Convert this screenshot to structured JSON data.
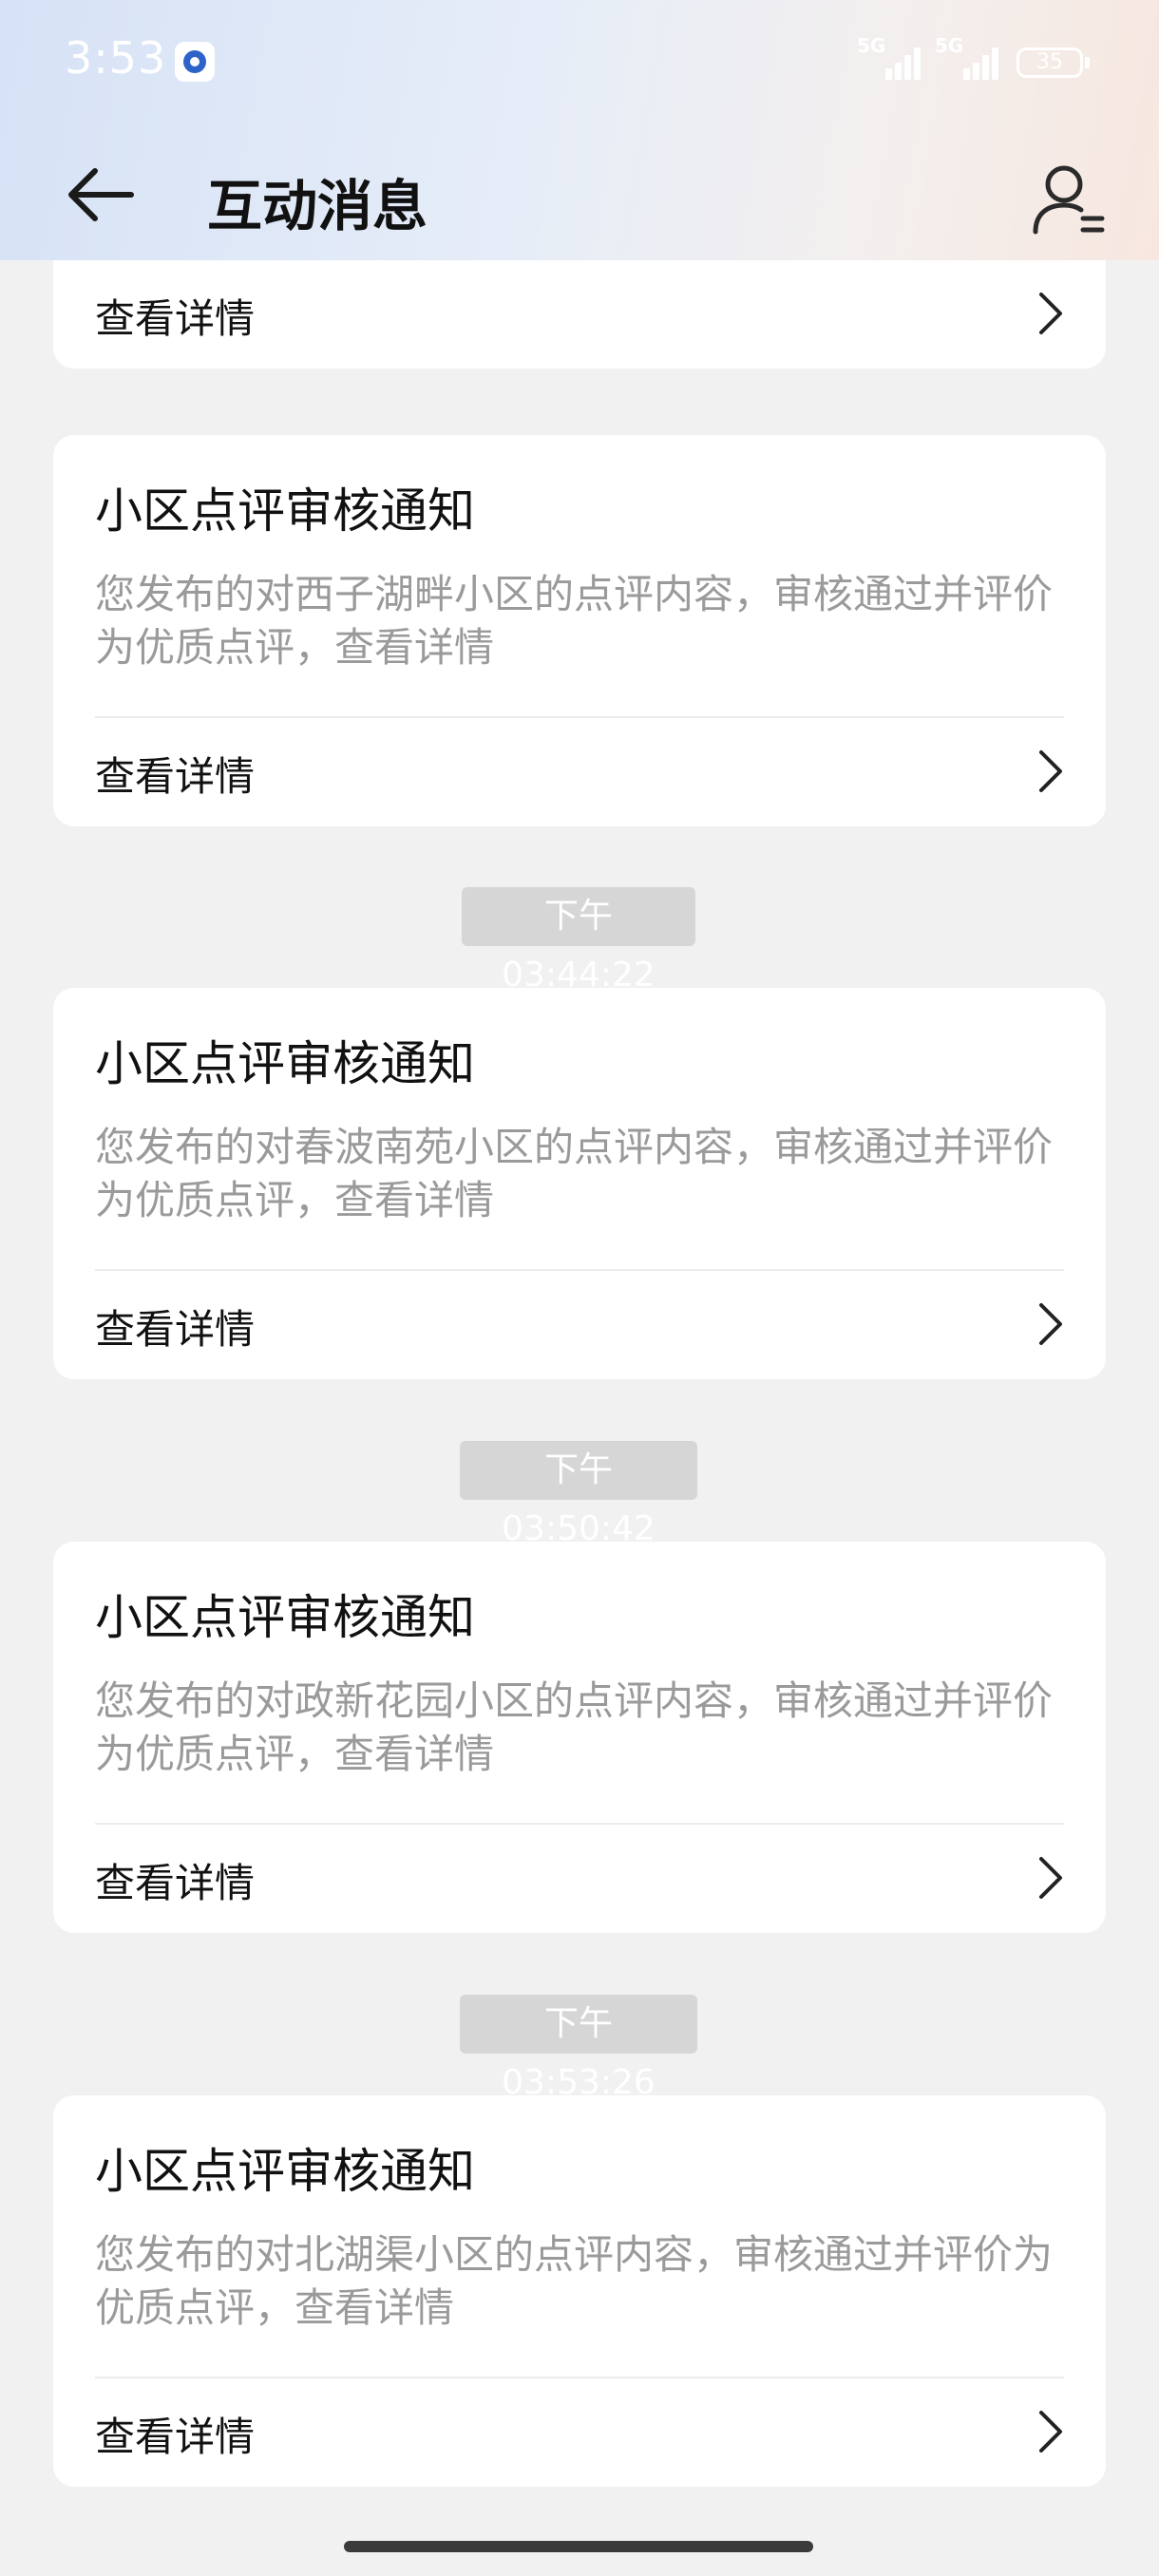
{
  "status_bar": {
    "time": "3:53",
    "signal_1_label": "5G",
    "signal_2_label": "5G",
    "battery": "35"
  },
  "header": {
    "title": "互动消息"
  },
  "partial_card": {
    "link_label": "查看详情"
  },
  "messages": [
    {
      "time": "",
      "title": "小区点评审核通知",
      "body": "您发布的对西子湖畔小区的点评内容，审核通过并评价为优质点评，查看详情",
      "link_label": "查看详情"
    },
    {
      "time": "下午03:44:22",
      "title": "小区点评审核通知",
      "body": "您发布的对春波南苑小区的点评内容，审核通过并评价为优质点评，查看详情",
      "link_label": "查看详情"
    },
    {
      "time": "下午03:50:42",
      "title": "小区点评审核通知",
      "body": "您发布的对政新花园小区的点评内容，审核通过并评价为优质点评，查看详情",
      "link_label": "查看详情"
    },
    {
      "time": "下午03:53:26",
      "title": "小区点评审核通知",
      "body": "您发布的对北湖渠小区的点评内容，审核通过并评价为优质点评，查看详情",
      "link_label": "查看详情"
    }
  ],
  "icons": {
    "back": "arrow-left-icon",
    "profile": "user-settings-icon",
    "chevron": "chevron-right-icon"
  }
}
